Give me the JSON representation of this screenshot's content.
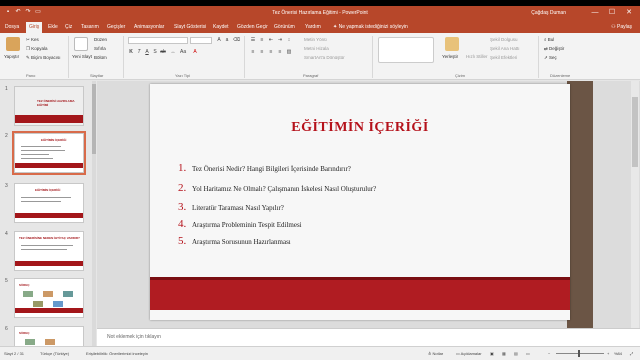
{
  "window": {
    "title": "Tez Önerisi Hazırlama Eğitimi  -  PowerPoint",
    "user": "Çağdaş Duman",
    "minimize": "—",
    "maximize": "☐",
    "close": "✕"
  },
  "tabs": [
    "Dosya",
    "Giriş",
    "Ekle",
    "Çiz",
    "Tasarım",
    "Geçişler",
    "Animasyonlar",
    "Slayt Gösterisi",
    "Kaydet",
    "Gözden Geçir",
    "Görünüm",
    "Yardım"
  ],
  "tell_me": "Ne yapmak istediğinizi söyleyin",
  "share": "Paylaş",
  "ribbon": {
    "clipboard": {
      "paste": "Yapıştır",
      "cut": "Kes",
      "copy": "Kopyala",
      "format_painter": "Biçim Boyacısı",
      "label": "Pano"
    },
    "slides": {
      "new_slide": "Yeni Slayt",
      "layout": "Düzen",
      "reset": "Sıfırla",
      "section": "Bölüm",
      "label": "Slaytlar"
    },
    "font": {
      "font_name": "",
      "font_size": "",
      "label": "Yazı Tipi"
    },
    "paragraph": {
      "text_direction": "Metin Yönü",
      "align_text": "Metni Hizala",
      "smartart": "SmartArt'a Dönüştür",
      "label": "Paragraf"
    },
    "drawing": {
      "arrange": "Yerleştir",
      "quick_styles": "Hızlı Stiller",
      "fill": "Şekil Dolgusu",
      "outline": "Şekil Ana Hattı",
      "effects": "Şekil Efektleri",
      "label": "Çizim"
    },
    "editing": {
      "find": "Bul",
      "replace": "Değiştir",
      "select": "Seç",
      "label": "Düzenleme"
    }
  },
  "thumbnails": [
    {
      "num": "1",
      "heading": "TEZ ÖNERİSİ HAZIRLAMA EĞİTİMİ"
    },
    {
      "num": "2",
      "heading": "EĞİTİMİN İÇERİĞİ"
    },
    {
      "num": "3",
      "heading": "EĞİTİMİN İÇERİĞİ"
    },
    {
      "num": "4",
      "heading": "TEZ ÖNERİSİNE NEDEN İHTİYAÇ VARDIR?"
    },
    {
      "num": "5",
      "heading": "SÜREÇ"
    },
    {
      "num": "6",
      "heading": "SÜREÇ"
    }
  ],
  "slide": {
    "title": "EĞİTİMİN İÇERİĞİ",
    "items": [
      {
        "n": "1.",
        "text": "Tez Önerisi Nedir? Hangi Bilgileri İçerisinde Barındırır?"
      },
      {
        "n": "2.",
        "text": "Yol Haritamız Ne Olmalı? Çalışmanın İskelesi Nasıl Oluşturulur?"
      },
      {
        "n": "3.",
        "text": "Literatür Taraması Nasıl Yapılır?"
      },
      {
        "n": "4.",
        "text": "Araştırma Probleminin Tespit Edilmesi"
      },
      {
        "n": "5.",
        "text": "Araştırma Sorusunun Hazırlanması"
      }
    ]
  },
  "notes_placeholder": "Not eklemek için tıklayın",
  "status": {
    "slide_info": "Slayt 2 / 31",
    "language": "Türkçe (Türkiye)",
    "accessibility": "Erişilebilirlik: Önerilerimizi inceleyin",
    "notes": "Notlar",
    "comments": "Açıklamalar",
    "zoom": "%84"
  },
  "colors": {
    "accent": "#b7472a",
    "slide_red": "#b01c22"
  }
}
